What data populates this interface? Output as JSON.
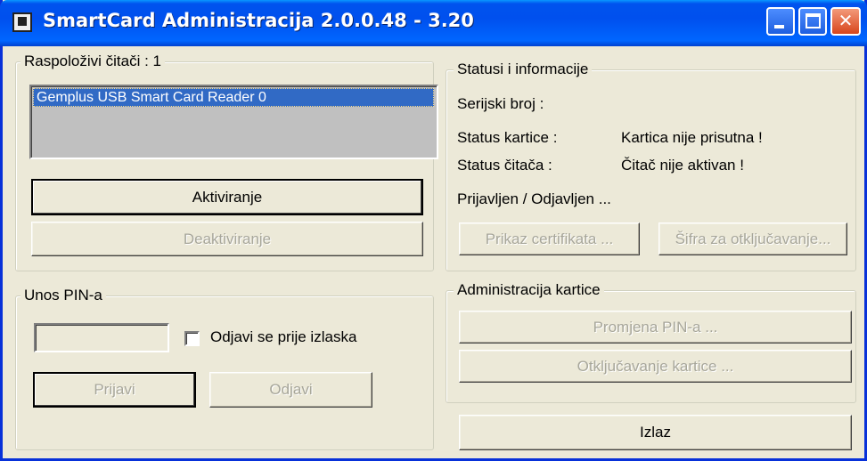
{
  "window": {
    "title": "SmartCard Administracija 2.0.0.48 - 3.20"
  },
  "readers": {
    "legend": "Raspoloživi čitači : 1",
    "items": [
      "Gemplus USB Smart Card Reader 0"
    ],
    "activate_label": "Aktiviranje",
    "deactivate_label": "Deaktiviranje"
  },
  "status": {
    "legend": "Statusi i informacije",
    "serial_label": "Serijski broj :",
    "serial_value": "",
    "card_status_label": "Status kartice :",
    "card_status_value": "Kartica nije prisutna !",
    "reader_status_label": "Status čitača :",
    "reader_status_value": "Čitač nije aktivan !",
    "login_state": "Prijavljen / Odjavljen ...",
    "show_cert_label": "Prikaz certifikata ...",
    "unlock_code_label": "Šifra za otključavanje..."
  },
  "pin": {
    "legend": "Unos PIN-a",
    "value": "",
    "logout_checkbox_label": "Odjavi se prije izlaska",
    "logout_checked": false,
    "login_label": "Prijavi",
    "logout_label": "Odjavi"
  },
  "admin": {
    "legend": "Administracija kartice",
    "change_pin_label": "Promjena PIN-a ...",
    "unlock_card_label": "Otključavanje kartice ..."
  },
  "exit_label": "Izlaz"
}
